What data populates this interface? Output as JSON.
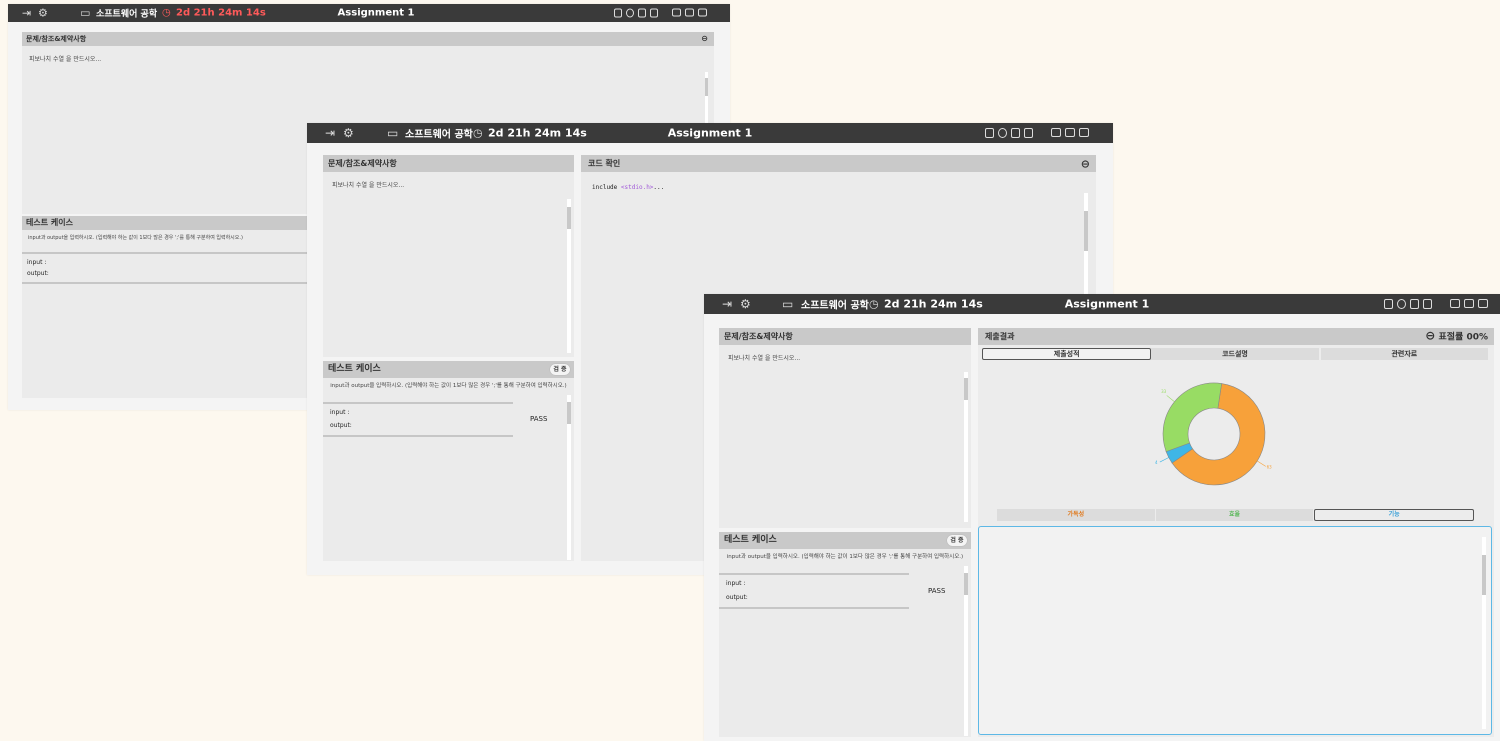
{
  "window": {
    "timer_icon": "stopwatch-icon",
    "course_icon": "monitor-icon",
    "course": "소프트웨어 공학",
    "timer": "2d 21h 24m 14s",
    "title": "Assignment 1",
    "left_icons": [
      "exit-icon",
      "gear-icon"
    ],
    "tool_icons": [
      "copy-icon",
      "refresh-icon",
      "save-icon",
      "export-icon",
      "folder-icon",
      "folder-icon",
      "folder-icon"
    ]
  },
  "problem": {
    "header": "문제/참조&제약사항",
    "text": "피보나치 수열 을 만드시오..."
  },
  "testcase": {
    "header": "테스트 케이스",
    "verify_label": "검 증",
    "instruction": "input과 output을 입력하시오. (입력해야 하는 값이 1보다 많은 경우 ';'를 통해 구분하여 입력하시오.)",
    "input_label": "input :",
    "output_label": "output:",
    "result": "PASS"
  },
  "code": {
    "header": "코드 확인",
    "line_prefix": "include ",
    "line_include": "<stdio.h>",
    "line_suffix": "..."
  },
  "result": {
    "header": "제출결과",
    "plagiarism": "표절률 00%",
    "tabs": [
      "제출성적",
      "코드설명",
      "관련자료"
    ],
    "active_tab": 0,
    "bottom_tabs": [
      "가독성",
      "효율",
      "기능"
    ],
    "bottom_colors": [
      "#e07b20",
      "#5cb85c",
      "#3aa0d8"
    ],
    "active_bottom_tab": 2
  },
  "chart_data": {
    "type": "pie",
    "values": [
      63,
      4,
      33
    ],
    "colors": [
      "#f7a13a",
      "#3fb6e6",
      "#98dc64"
    ],
    "value_labels": [
      "63",
      "4",
      "33"
    ]
  }
}
